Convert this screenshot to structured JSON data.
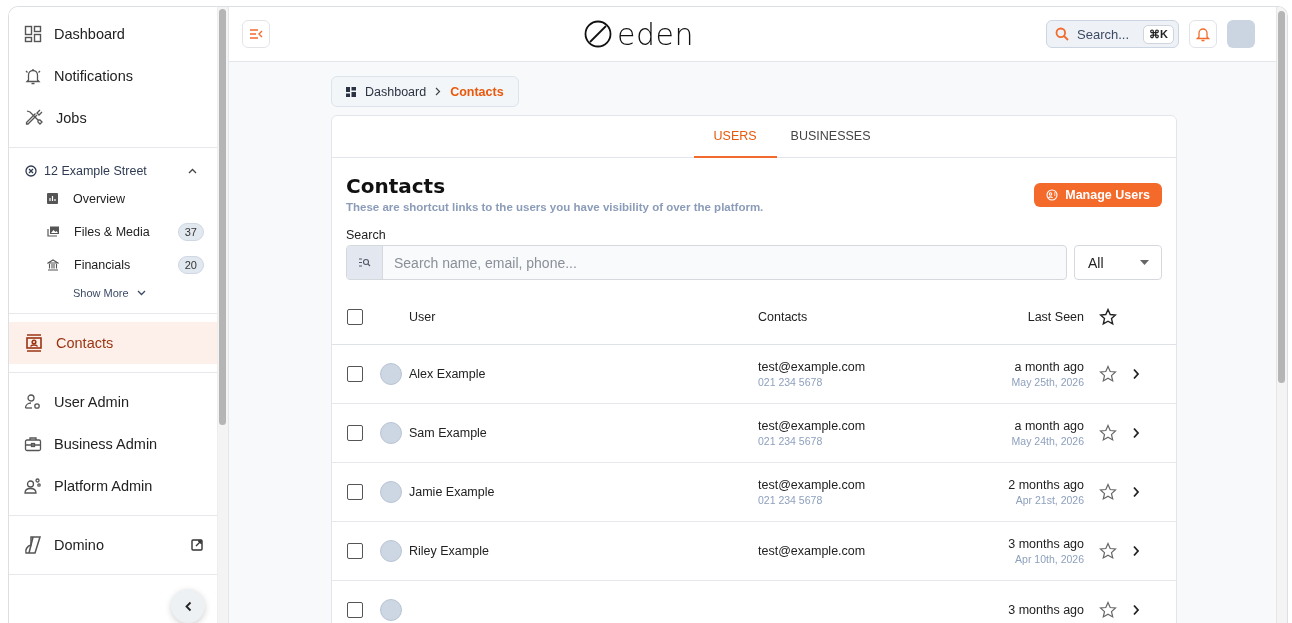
{
  "sidebar": {
    "groups": [
      {
        "items": [
          {
            "label": "Dashboard",
            "selected": false,
            "external": false
          },
          {
            "label": "Notifications",
            "selected": false,
            "external": false
          },
          {
            "label": "Jobs",
            "selected": false,
            "external": false
          }
        ]
      },
      {
        "property": {
          "title": "12 Example Street",
          "expanded": true,
          "items": [
            {
              "label": "Overview"
            },
            {
              "label": "Files & Media",
              "count": "37"
            },
            {
              "label": "Financials",
              "count": "20"
            }
          ],
          "show_more": "Show More"
        }
      },
      {
        "items": [
          {
            "label": "Contacts",
            "selected": true,
            "external": false
          }
        ]
      },
      {
        "items": [
          {
            "label": "User Admin",
            "selected": false,
            "external": false
          },
          {
            "label": "Business Admin",
            "selected": false,
            "external": false
          },
          {
            "label": "Platform Admin",
            "selected": false,
            "external": false
          }
        ]
      },
      {
        "items": [
          {
            "label": "Domino",
            "selected": false,
            "external": true
          }
        ]
      }
    ]
  },
  "topbar": {
    "logo": "eden",
    "search": {
      "placeholder": "Search...",
      "shortcut": "⌘K"
    }
  },
  "breadcrumb": [
    {
      "label": "Dashboard",
      "current": false
    },
    {
      "label": "Contacts",
      "current": true
    }
  ],
  "tabs": [
    {
      "label": "USERS",
      "selected": true
    },
    {
      "label": "BUSINESSES",
      "selected": false
    }
  ],
  "header": {
    "title": "Contacts",
    "subtitle": "These are shortcut links to the users you have visibility of over the platform.",
    "button": "Manage Users"
  },
  "search": {
    "label": "Search",
    "placeholder": "Search name, email, phone...",
    "filter": "All"
  },
  "table": {
    "select_all": {
      "checked": false
    },
    "columns": [
      "User",
      "Contacts",
      "Last Seen"
    ],
    "rows": [
      {
        "name": "Alex Example",
        "email": "test@example.com",
        "phone": "021 234 5678",
        "last_seen": "a month ago",
        "date": "May 25th, 2026",
        "checked": false,
        "starred": false
      },
      {
        "name": "Sam Example",
        "email": "test@example.com",
        "phone": "021 234 5678",
        "last_seen": "a month ago",
        "date": "May 24th, 2026",
        "checked": false,
        "starred": false
      },
      {
        "name": "Jamie Example",
        "email": "test@example.com",
        "phone": "021 234 5678",
        "last_seen": "2 months ago",
        "date": "Apr 21st, 2026",
        "checked": false,
        "starred": false
      },
      {
        "name": "Riley Example",
        "email": "test@example.com",
        "last_seen": "3 months ago",
        "date": "Apr 10th, 2026",
        "checked": false,
        "starred": false
      },
      {
        "last_seen": "3 months ago",
        "checked": false,
        "starred": false
      }
    ]
  }
}
